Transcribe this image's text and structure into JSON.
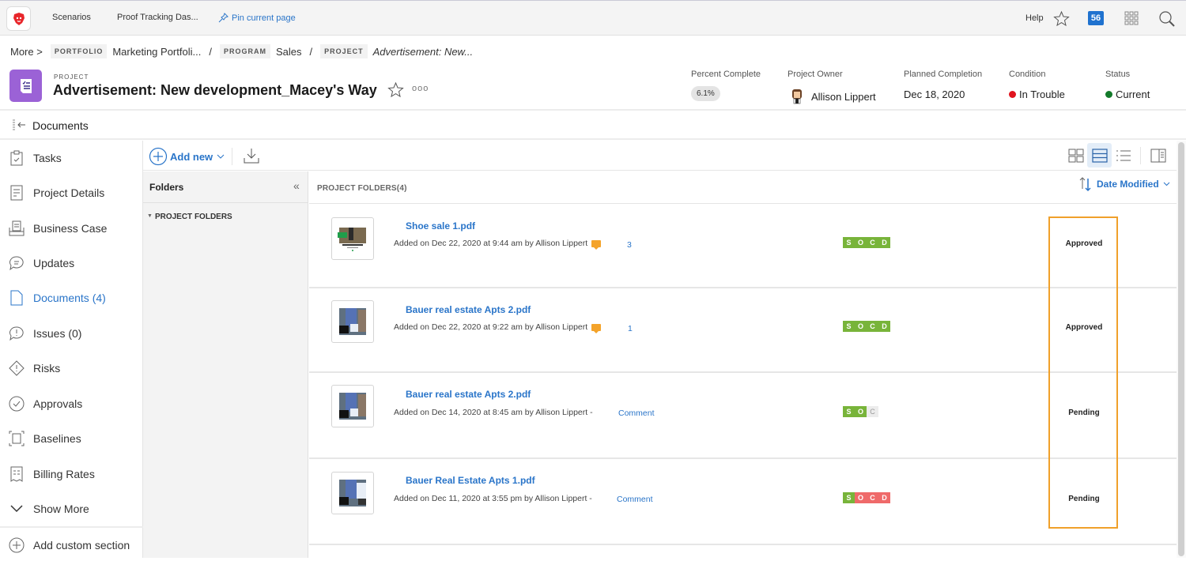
{
  "topbar": {
    "nav": [
      "Scenarios",
      "Proof Tracking Das..."
    ],
    "pin_label": "Pin current page",
    "help_label": "Help",
    "notification_count": "56"
  },
  "breadcrumb": {
    "more": "More >",
    "items": [
      {
        "tag": "PORTFOLIO",
        "text": "Marketing Portfoli..."
      },
      {
        "tag": "PROGRAM",
        "text": "Sales"
      },
      {
        "tag": "PROJECT",
        "text": "Advertisement: New..."
      }
    ],
    "separator": "/"
  },
  "project": {
    "type_label": "PROJECT",
    "title": "Advertisement: New development_Macey's Way",
    "more": "ooo",
    "fields": {
      "percent_complete_label": "Percent Complete",
      "percent_complete": "6.1%",
      "owner_label": "Project Owner",
      "owner": "Allison Lippert",
      "planned_completion_label": "Planned Completion",
      "planned_completion": "Dec 18, 2020",
      "condition_label": "Condition",
      "condition": "In Trouble",
      "condition_color": "#e0141e",
      "status_label": "Status",
      "status": "Current",
      "status_color": "#137a2a"
    }
  },
  "section_title": "Documents",
  "sidebar": {
    "items": [
      {
        "label": "Tasks",
        "icon": "clipboard-icon"
      },
      {
        "label": "Project Details",
        "icon": "document-icon"
      },
      {
        "label": "Business Case",
        "icon": "business-case-icon"
      },
      {
        "label": "Updates",
        "icon": "chat-bubble-icon"
      },
      {
        "label": "Documents (4)",
        "icon": "file-icon",
        "active": true
      },
      {
        "label": "Issues (0)",
        "icon": "issue-icon"
      },
      {
        "label": "Risks",
        "icon": "warning-diamond-icon"
      },
      {
        "label": "Approvals",
        "icon": "check-circle-icon"
      },
      {
        "label": "Baselines",
        "icon": "baseline-icon"
      },
      {
        "label": "Billing Rates",
        "icon": "receipt-icon"
      },
      {
        "label": "Show More",
        "icon": "chevron-down-icon"
      }
    ],
    "add_custom": "Add custom section"
  },
  "toolbar": {
    "add_new": "Add new"
  },
  "folders": {
    "title": "Folders",
    "root": "PROJECT FOLDERS"
  },
  "main": {
    "header": "PROJECT FOLDERS(4)",
    "sort_label": "Date Modified",
    "documents": [
      {
        "name": "Shoe sale 1.pdf",
        "meta": "Added on Dec 22, 2020 at 9:44 am by Allison Lippert",
        "comments": "3",
        "socd": [
          "g",
          "g",
          "g",
          "g"
        ],
        "socd_letters": [
          "S",
          "O",
          "C",
          "D"
        ],
        "status": "Approved"
      },
      {
        "name": "Bauer real estate Apts 2.pdf",
        "meta": "Added on Dec 22, 2020 at 9:22 am by Allison Lippert",
        "comments": "1",
        "socd": [
          "g",
          "g",
          "g",
          "g"
        ],
        "socd_letters": [
          "S",
          "O",
          "C",
          "D"
        ],
        "status": "Approved"
      },
      {
        "name": "Bauer real estate Apts 2.pdf",
        "meta": "Added on Dec 14, 2020 at 8:45 am by Allison Lippert -",
        "comment_link": "Comment",
        "socd": [
          "g",
          "g",
          "n"
        ],
        "socd_letters": [
          "S",
          "O",
          "C"
        ],
        "status": "Pending"
      },
      {
        "name": "Bauer Real Estate Apts 1.pdf",
        "meta": "Added on Dec 11, 2020 at 3:55 pm by Allison Lippert -",
        "comment_link": "Comment",
        "socd": [
          "g",
          "r",
          "r",
          "r"
        ],
        "socd_letters": [
          "S",
          "O",
          "C",
          "D"
        ],
        "status": "Pending"
      }
    ]
  }
}
